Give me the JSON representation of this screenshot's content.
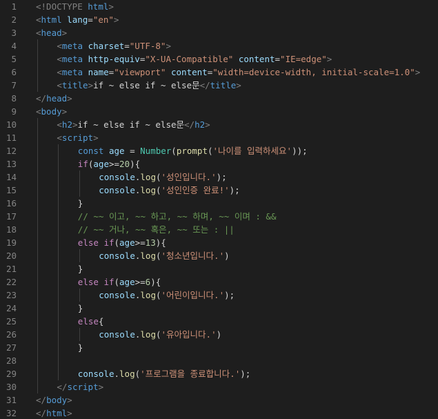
{
  "editor": {
    "language": "html",
    "colors": {
      "background": "#1e1e1e",
      "line_number": "#858585",
      "punctuation": "#808080",
      "tag": "#569cd6",
      "attribute": "#9cdcfe",
      "string": "#ce9178",
      "text": "#d4d4d4",
      "keyword": "#569cd6",
      "control": "#c586c0",
      "variable": "#9cdcfe",
      "function": "#dcdcaa",
      "class": "#4ec9b0",
      "number": "#b5cea8",
      "comment": "#6a9955"
    },
    "lines": [
      {
        "n": "1",
        "indent": 0,
        "tokens": [
          {
            "t": "<!DOCTYPE ",
            "c": "punct"
          },
          {
            "t": "html",
            "c": "tag"
          },
          {
            "t": ">",
            "c": "punct"
          }
        ]
      },
      {
        "n": "2",
        "indent": 0,
        "tokens": [
          {
            "t": "<",
            "c": "punct"
          },
          {
            "t": "html",
            "c": "tag"
          },
          {
            "t": " ",
            "c": "text"
          },
          {
            "t": "lang",
            "c": "attr"
          },
          {
            "t": "=",
            "c": "text"
          },
          {
            "t": "\"en\"",
            "c": "str"
          },
          {
            "t": ">",
            "c": "punct"
          }
        ]
      },
      {
        "n": "3",
        "indent": 0,
        "tokens": [
          {
            "t": "<",
            "c": "punct"
          },
          {
            "t": "head",
            "c": "tag"
          },
          {
            "t": ">",
            "c": "punct"
          }
        ]
      },
      {
        "n": "4",
        "indent": 1,
        "tokens": [
          {
            "t": "<",
            "c": "punct"
          },
          {
            "t": "meta",
            "c": "tag"
          },
          {
            "t": " ",
            "c": "text"
          },
          {
            "t": "charset",
            "c": "attr"
          },
          {
            "t": "=",
            "c": "text"
          },
          {
            "t": "\"UTF-8\"",
            "c": "str"
          },
          {
            "t": ">",
            "c": "punct"
          }
        ]
      },
      {
        "n": "5",
        "indent": 1,
        "tokens": [
          {
            "t": "<",
            "c": "punct"
          },
          {
            "t": "meta",
            "c": "tag"
          },
          {
            "t": " ",
            "c": "text"
          },
          {
            "t": "http-equiv",
            "c": "attr"
          },
          {
            "t": "=",
            "c": "text"
          },
          {
            "t": "\"X-UA-Compatible\"",
            "c": "str"
          },
          {
            "t": " ",
            "c": "text"
          },
          {
            "t": "content",
            "c": "attr"
          },
          {
            "t": "=",
            "c": "text"
          },
          {
            "t": "\"IE=edge\"",
            "c": "str"
          },
          {
            "t": ">",
            "c": "punct"
          }
        ]
      },
      {
        "n": "6",
        "indent": 1,
        "tokens": [
          {
            "t": "<",
            "c": "punct"
          },
          {
            "t": "meta",
            "c": "tag"
          },
          {
            "t": " ",
            "c": "text"
          },
          {
            "t": "name",
            "c": "attr"
          },
          {
            "t": "=",
            "c": "text"
          },
          {
            "t": "\"viewport\"",
            "c": "str"
          },
          {
            "t": " ",
            "c": "text"
          },
          {
            "t": "content",
            "c": "attr"
          },
          {
            "t": "=",
            "c": "text"
          },
          {
            "t": "\"width=device-width, initial-scale=1.0\"",
            "c": "str"
          },
          {
            "t": ">",
            "c": "punct"
          }
        ]
      },
      {
        "n": "7",
        "indent": 1,
        "tokens": [
          {
            "t": "<",
            "c": "punct"
          },
          {
            "t": "title",
            "c": "tag"
          },
          {
            "t": ">",
            "c": "punct"
          },
          {
            "t": "if ~ else if ~ else문",
            "c": "text"
          },
          {
            "t": "</",
            "c": "punct"
          },
          {
            "t": "title",
            "c": "tag"
          },
          {
            "t": ">",
            "c": "punct"
          }
        ]
      },
      {
        "n": "8",
        "indent": 0,
        "tokens": [
          {
            "t": "</",
            "c": "punct"
          },
          {
            "t": "head",
            "c": "tag"
          },
          {
            "t": ">",
            "c": "punct"
          }
        ]
      },
      {
        "n": "9",
        "indent": 0,
        "tokens": [
          {
            "t": "<",
            "c": "punct"
          },
          {
            "t": "body",
            "c": "tag"
          },
          {
            "t": ">",
            "c": "punct"
          }
        ]
      },
      {
        "n": "10",
        "indent": 1,
        "tokens": [
          {
            "t": "<",
            "c": "punct"
          },
          {
            "t": "h2",
            "c": "tag"
          },
          {
            "t": ">",
            "c": "punct"
          },
          {
            "t": "if ~ else if ~ else문",
            "c": "text"
          },
          {
            "t": "</",
            "c": "punct"
          },
          {
            "t": "h2",
            "c": "tag"
          },
          {
            "t": ">",
            "c": "punct"
          }
        ]
      },
      {
        "n": "11",
        "indent": 1,
        "tokens": [
          {
            "t": "<",
            "c": "punct"
          },
          {
            "t": "script",
            "c": "tag"
          },
          {
            "t": ">",
            "c": "punct"
          }
        ]
      },
      {
        "n": "12",
        "indent": 2,
        "tokens": [
          {
            "t": "const",
            "c": "kw"
          },
          {
            "t": " ",
            "c": "text"
          },
          {
            "t": "age",
            "c": "var"
          },
          {
            "t": " = ",
            "c": "op"
          },
          {
            "t": "Number",
            "c": "cls"
          },
          {
            "t": "(",
            "c": "op"
          },
          {
            "t": "prompt",
            "c": "fn"
          },
          {
            "t": "(",
            "c": "op"
          },
          {
            "t": "'나이를 입력하세요'",
            "c": "str"
          },
          {
            "t": "));",
            "c": "op"
          }
        ]
      },
      {
        "n": "13",
        "indent": 2,
        "tokens": [
          {
            "t": "if",
            "c": "ctrl"
          },
          {
            "t": "(",
            "c": "op"
          },
          {
            "t": "age",
            "c": "var"
          },
          {
            "t": ">=",
            "c": "op"
          },
          {
            "t": "20",
            "c": "num"
          },
          {
            "t": "){",
            "c": "op"
          }
        ]
      },
      {
        "n": "14",
        "indent": 3,
        "tokens": [
          {
            "t": "console",
            "c": "var"
          },
          {
            "t": ".",
            "c": "op"
          },
          {
            "t": "log",
            "c": "fn"
          },
          {
            "t": "(",
            "c": "op"
          },
          {
            "t": "'성인입니다.'",
            "c": "str"
          },
          {
            "t": ");",
            "c": "op"
          }
        ]
      },
      {
        "n": "15",
        "indent": 3,
        "tokens": [
          {
            "t": "console",
            "c": "var"
          },
          {
            "t": ".",
            "c": "op"
          },
          {
            "t": "log",
            "c": "fn"
          },
          {
            "t": "(",
            "c": "op"
          },
          {
            "t": "'성인인증 완료!'",
            "c": "str"
          },
          {
            "t": ");",
            "c": "op"
          }
        ]
      },
      {
        "n": "16",
        "indent": 2,
        "tokens": [
          {
            "t": "}",
            "c": "op"
          }
        ]
      },
      {
        "n": "17",
        "indent": 2,
        "tokens": [
          {
            "t": "// ~~ 이고, ~~ 하고, ~~ 하며, ~~ 이며 : &&",
            "c": "cm"
          }
        ]
      },
      {
        "n": "18",
        "indent": 2,
        "tokens": [
          {
            "t": "// ~~ 거나, ~~ 혹은, ~~ 또는 : ||",
            "c": "cm"
          }
        ]
      },
      {
        "n": "19",
        "indent": 2,
        "tokens": [
          {
            "t": "else",
            "c": "ctrl"
          },
          {
            "t": " ",
            "c": "text"
          },
          {
            "t": "if",
            "c": "ctrl"
          },
          {
            "t": "(",
            "c": "op"
          },
          {
            "t": "age",
            "c": "var"
          },
          {
            "t": ">=",
            "c": "op"
          },
          {
            "t": "13",
            "c": "num"
          },
          {
            "t": "){",
            "c": "op"
          }
        ]
      },
      {
        "n": "20",
        "indent": 3,
        "tokens": [
          {
            "t": "console",
            "c": "var"
          },
          {
            "t": ".",
            "c": "op"
          },
          {
            "t": "log",
            "c": "fn"
          },
          {
            "t": "(",
            "c": "op"
          },
          {
            "t": "'청소년입니다.'",
            "c": "str"
          },
          {
            "t": ")",
            "c": "op"
          }
        ]
      },
      {
        "n": "21",
        "indent": 2,
        "tokens": [
          {
            "t": "}",
            "c": "op"
          }
        ]
      },
      {
        "n": "22",
        "indent": 2,
        "tokens": [
          {
            "t": "else",
            "c": "ctrl"
          },
          {
            "t": " ",
            "c": "text"
          },
          {
            "t": "if",
            "c": "ctrl"
          },
          {
            "t": "(",
            "c": "op"
          },
          {
            "t": "age",
            "c": "var"
          },
          {
            "t": ">=",
            "c": "op"
          },
          {
            "t": "6",
            "c": "num"
          },
          {
            "t": "){",
            "c": "op"
          }
        ]
      },
      {
        "n": "23",
        "indent": 3,
        "tokens": [
          {
            "t": "console",
            "c": "var"
          },
          {
            "t": ".",
            "c": "op"
          },
          {
            "t": "log",
            "c": "fn"
          },
          {
            "t": "(",
            "c": "op"
          },
          {
            "t": "'어린이입니다.'",
            "c": "str"
          },
          {
            "t": ");",
            "c": "op"
          }
        ]
      },
      {
        "n": "24",
        "indent": 2,
        "tokens": [
          {
            "t": "}",
            "c": "op"
          }
        ]
      },
      {
        "n": "25",
        "indent": 2,
        "tokens": [
          {
            "t": "else",
            "c": "ctrl"
          },
          {
            "t": "{",
            "c": "op"
          }
        ]
      },
      {
        "n": "26",
        "indent": 3,
        "tokens": [
          {
            "t": "console",
            "c": "var"
          },
          {
            "t": ".",
            "c": "op"
          },
          {
            "t": "log",
            "c": "fn"
          },
          {
            "t": "(",
            "c": "op"
          },
          {
            "t": "'유아입니다.'",
            "c": "str"
          },
          {
            "t": ")",
            "c": "op"
          }
        ]
      },
      {
        "n": "27",
        "indent": 2,
        "tokens": [
          {
            "t": "}",
            "c": "op"
          }
        ]
      },
      {
        "n": "28",
        "indent": 2,
        "tokens": []
      },
      {
        "n": "29",
        "indent": 2,
        "tokens": [
          {
            "t": "console",
            "c": "var"
          },
          {
            "t": ".",
            "c": "op"
          },
          {
            "t": "log",
            "c": "fn"
          },
          {
            "t": "(",
            "c": "op"
          },
          {
            "t": "'프로그램을 종료합니다.'",
            "c": "str"
          },
          {
            "t": ");",
            "c": "op"
          }
        ]
      },
      {
        "n": "30",
        "indent": 1,
        "tokens": [
          {
            "t": "</",
            "c": "punct"
          },
          {
            "t": "script",
            "c": "tag"
          },
          {
            "t": ">",
            "c": "punct"
          }
        ]
      },
      {
        "n": "31",
        "indent": 0,
        "tokens": [
          {
            "t": "</",
            "c": "punct"
          },
          {
            "t": "body",
            "c": "tag"
          },
          {
            "t": ">",
            "c": "punct"
          }
        ]
      },
      {
        "n": "32",
        "indent": 0,
        "tokens": [
          {
            "t": "</",
            "c": "punct"
          },
          {
            "t": "html",
            "c": "tag"
          },
          {
            "t": ">",
            "c": "punct"
          }
        ]
      }
    ]
  }
}
